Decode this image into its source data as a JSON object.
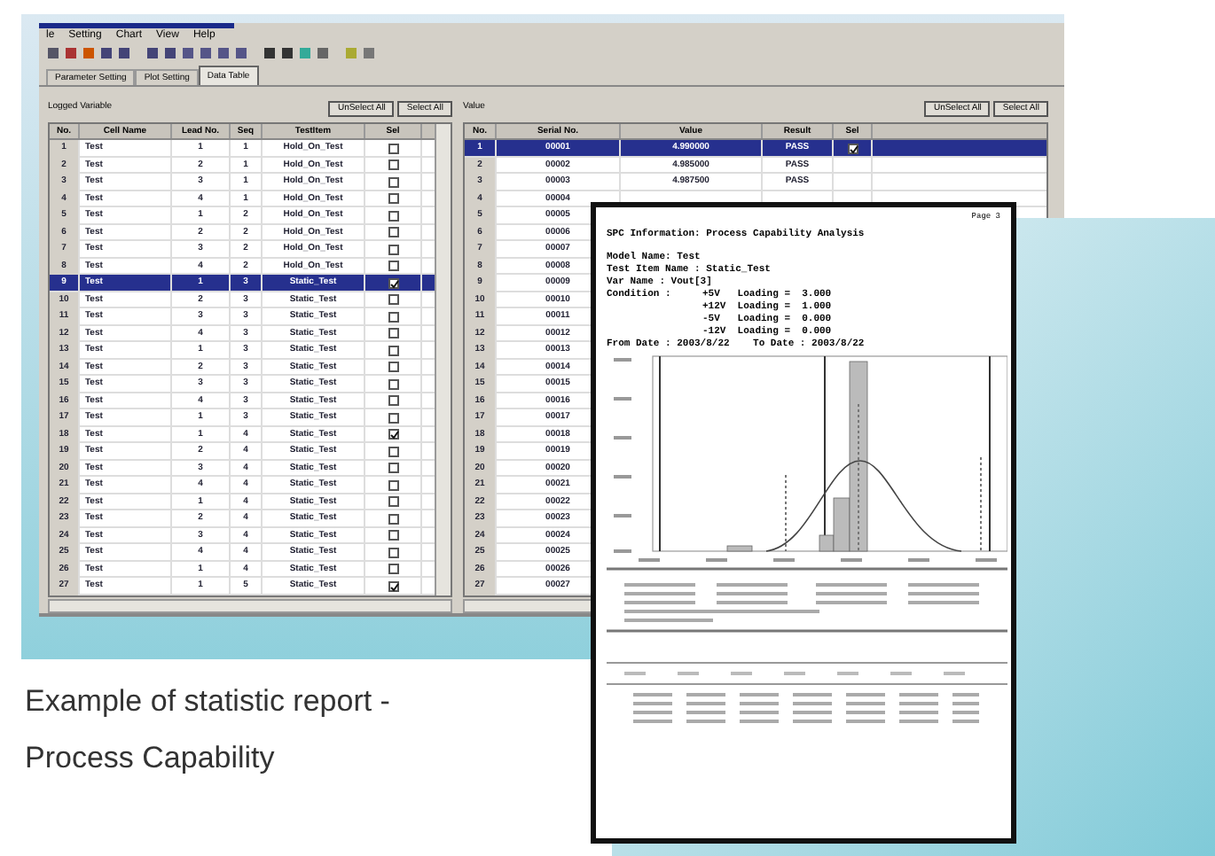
{
  "app": {
    "menu": [
      "le",
      "Setting",
      "Chart",
      "View",
      "Help"
    ],
    "tabs": [
      {
        "label": "Parameter Setting",
        "selected": false
      },
      {
        "label": "Plot Setting",
        "selected": false
      },
      {
        "label": "Data Table",
        "selected": true
      }
    ],
    "left_group": {
      "title": "Logged Variable",
      "buttons": [
        "UnSelect All",
        "Select All"
      ],
      "columns": [
        "No.",
        "Cell Name",
        "Lead No.",
        "Seq",
        "TestItem",
        "Sel"
      ],
      "rows": [
        {
          "no": "1",
          "cell": "Test",
          "lead": "1",
          "seq": "1",
          "item": "Hold_On_Test",
          "checked": false,
          "selected": false
        },
        {
          "no": "2",
          "cell": "Test",
          "lead": "2",
          "seq": "1",
          "item": "Hold_On_Test",
          "checked": false,
          "selected": false
        },
        {
          "no": "3",
          "cell": "Test",
          "lead": "3",
          "seq": "1",
          "item": "Hold_On_Test",
          "checked": false,
          "selected": false
        },
        {
          "no": "4",
          "cell": "Test",
          "lead": "4",
          "seq": "1",
          "item": "Hold_On_Test",
          "checked": false,
          "selected": false
        },
        {
          "no": "5",
          "cell": "Test",
          "lead": "1",
          "seq": "2",
          "item": "Hold_On_Test",
          "checked": false,
          "selected": false
        },
        {
          "no": "6",
          "cell": "Test",
          "lead": "2",
          "seq": "2",
          "item": "Hold_On_Test",
          "checked": false,
          "selected": false
        },
        {
          "no": "7",
          "cell": "Test",
          "lead": "3",
          "seq": "2",
          "item": "Hold_On_Test",
          "checked": false,
          "selected": false
        },
        {
          "no": "8",
          "cell": "Test",
          "lead": "4",
          "seq": "2",
          "item": "Hold_On_Test",
          "checked": false,
          "selected": false
        },
        {
          "no": "9",
          "cell": "Test",
          "lead": "1",
          "seq": "3",
          "item": "Static_Test",
          "checked": true,
          "selected": true
        },
        {
          "no": "10",
          "cell": "Test",
          "lead": "2",
          "seq": "3",
          "item": "Static_Test",
          "checked": false,
          "selected": false
        },
        {
          "no": "11",
          "cell": "Test",
          "lead": "3",
          "seq": "3",
          "item": "Static_Test",
          "checked": false,
          "selected": false
        },
        {
          "no": "12",
          "cell": "Test",
          "lead": "4",
          "seq": "3",
          "item": "Static_Test",
          "checked": false,
          "selected": false
        },
        {
          "no": "13",
          "cell": "Test",
          "lead": "1",
          "seq": "3",
          "item": "Static_Test",
          "checked": false,
          "selected": false
        },
        {
          "no": "14",
          "cell": "Test",
          "lead": "2",
          "seq": "3",
          "item": "Static_Test",
          "checked": false,
          "selected": false
        },
        {
          "no": "15",
          "cell": "Test",
          "lead": "3",
          "seq": "3",
          "item": "Static_Test",
          "checked": false,
          "selected": false
        },
        {
          "no": "16",
          "cell": "Test",
          "lead": "4",
          "seq": "3",
          "item": "Static_Test",
          "checked": false,
          "selected": false
        },
        {
          "no": "17",
          "cell": "Test",
          "lead": "1",
          "seq": "3",
          "item": "Static_Test",
          "checked": false,
          "selected": false
        },
        {
          "no": "18",
          "cell": "Test",
          "lead": "1",
          "seq": "4",
          "item": "Static_Test",
          "checked": true,
          "selected": false
        },
        {
          "no": "19",
          "cell": "Test",
          "lead": "2",
          "seq": "4",
          "item": "Static_Test",
          "checked": false,
          "selected": false
        },
        {
          "no": "20",
          "cell": "Test",
          "lead": "3",
          "seq": "4",
          "item": "Static_Test",
          "checked": false,
          "selected": false
        },
        {
          "no": "21",
          "cell": "Test",
          "lead": "4",
          "seq": "4",
          "item": "Static_Test",
          "checked": false,
          "selected": false
        },
        {
          "no": "22",
          "cell": "Test",
          "lead": "1",
          "seq": "4",
          "item": "Static_Test",
          "checked": false,
          "selected": false
        },
        {
          "no": "23",
          "cell": "Test",
          "lead": "2",
          "seq": "4",
          "item": "Static_Test",
          "checked": false,
          "selected": false
        },
        {
          "no": "24",
          "cell": "Test",
          "lead": "3",
          "seq": "4",
          "item": "Static_Test",
          "checked": false,
          "selected": false
        },
        {
          "no": "25",
          "cell": "Test",
          "lead": "4",
          "seq": "4",
          "item": "Static_Test",
          "checked": false,
          "selected": false
        },
        {
          "no": "26",
          "cell": "Test",
          "lead": "1",
          "seq": "4",
          "item": "Static_Test",
          "checked": false,
          "selected": false
        },
        {
          "no": "27",
          "cell": "Test",
          "lead": "1",
          "seq": "5",
          "item": "Static_Test",
          "checked": true,
          "selected": false
        }
      ]
    },
    "right_group": {
      "title": "Value",
      "buttons": [
        "UnSelect All",
        "Select All"
      ],
      "columns": [
        "No.",
        "Serial No.",
        "Value",
        "Result",
        "Sel"
      ],
      "rows": [
        {
          "no": "1",
          "serial": "00001",
          "value": "4.990000",
          "result": "PASS",
          "checked": true,
          "selected": true
        },
        {
          "no": "2",
          "serial": "00002",
          "value": "4.985000",
          "result": "PASS",
          "selected": false
        },
        {
          "no": "3",
          "serial": "00003",
          "value": "4.987500",
          "result": "PASS",
          "selected": false
        },
        {
          "no": "4",
          "serial": "00004",
          "selected": false
        },
        {
          "no": "5",
          "serial": "00005",
          "selected": false
        },
        {
          "no": "6",
          "serial": "00006",
          "selected": false
        },
        {
          "no": "7",
          "serial": "00007",
          "selected": false
        },
        {
          "no": "8",
          "serial": "00008",
          "selected": false
        },
        {
          "no": "9",
          "serial": "00009",
          "selected": false
        },
        {
          "no": "10",
          "serial": "00010",
          "selected": false
        },
        {
          "no": "11",
          "serial": "00011",
          "selected": false
        },
        {
          "no": "12",
          "serial": "00012",
          "selected": false
        },
        {
          "no": "13",
          "serial": "00013",
          "selected": false
        },
        {
          "no": "14",
          "serial": "00014",
          "selected": false
        },
        {
          "no": "15",
          "serial": "00015",
          "selected": false
        },
        {
          "no": "16",
          "serial": "00016",
          "selected": false
        },
        {
          "no": "17",
          "serial": "00017",
          "selected": false
        },
        {
          "no": "18",
          "serial": "00018",
          "selected": false
        },
        {
          "no": "19",
          "serial": "00019",
          "selected": false
        },
        {
          "no": "20",
          "serial": "00020",
          "selected": false
        },
        {
          "no": "21",
          "serial": "00021",
          "selected": false
        },
        {
          "no": "22",
          "serial": "00022",
          "selected": false
        },
        {
          "no": "23",
          "serial": "00023",
          "selected": false
        },
        {
          "no": "24",
          "serial": "00024",
          "selected": false
        },
        {
          "no": "25",
          "serial": "00025",
          "selected": false
        },
        {
          "no": "26",
          "serial": "00026",
          "selected": false
        },
        {
          "no": "27",
          "serial": "00027",
          "selected": false
        }
      ]
    }
  },
  "report": {
    "page": "Page 3",
    "title": "SPC Information: Process Capability Analysis",
    "lines": [
      "Model Name: Test",
      "Test Item Name : Static_Test",
      "Var Name : Vout[3]"
    ],
    "condition_label": "Condition :",
    "conditions": [
      "+5V   Loading =  3.000",
      "+12V  Loading =  1.000",
      "-5V   Loading =  0.000",
      "-12V  Loading =  0.000"
    ],
    "date_line": "From Date : 2003/8/22    To Date : 2003/8/22"
  },
  "caption": [
    "Example of statistic report -",
    "Process Capability"
  ]
}
